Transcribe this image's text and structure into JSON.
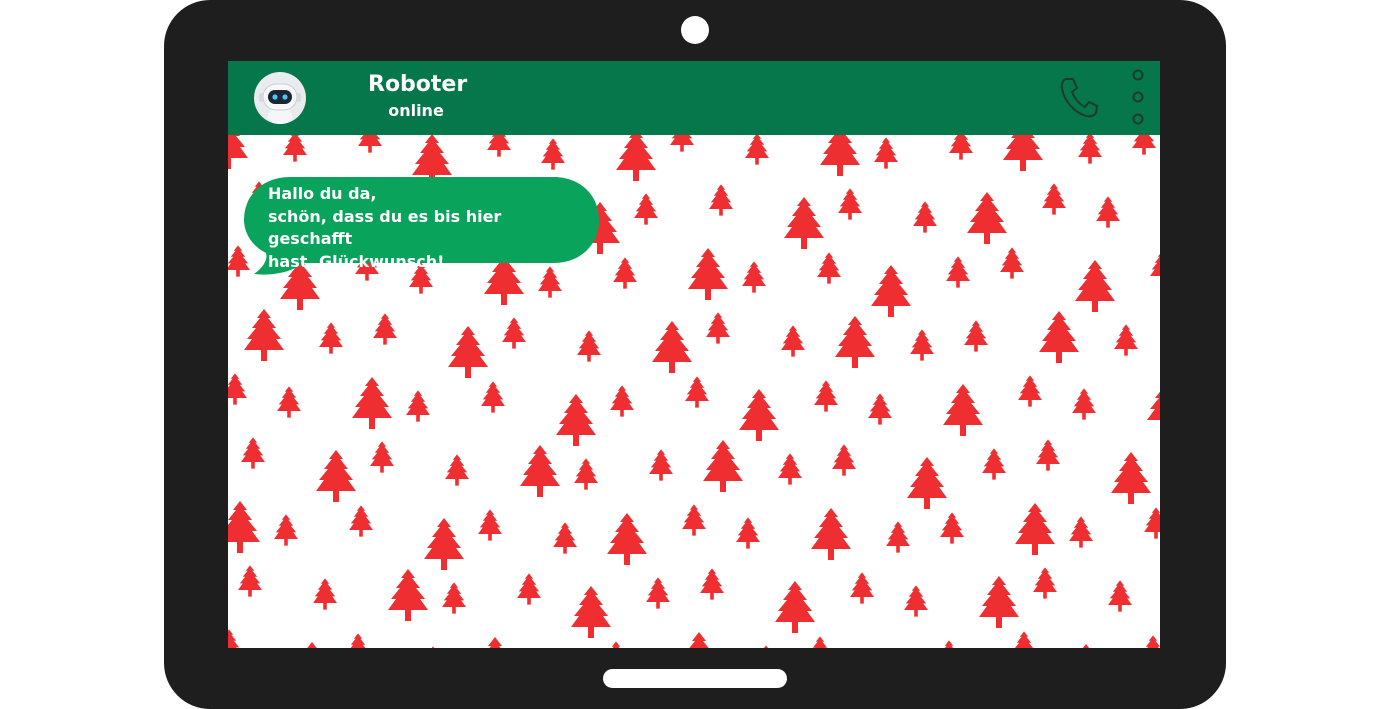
{
  "contact": {
    "name": "Roboter",
    "status": "online"
  },
  "message": {
    "text": "Hallo du da,\nschön, dass du es bis hier geschafft\nhast. Glückwunsch!"
  },
  "colors": {
    "header": "#06774a",
    "bubble": "#0aa35c",
    "tree": "#ee2e31",
    "device": "#1e1e1e"
  },
  "icons": {
    "call": "phone-icon",
    "menu": "more-vertical-icon",
    "avatar": "robot-avatar"
  }
}
